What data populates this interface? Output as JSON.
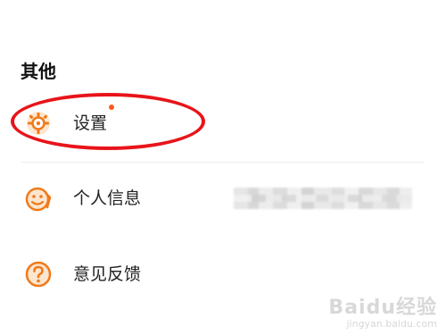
{
  "section": {
    "title": "其他"
  },
  "items": [
    {
      "label": "设置",
      "icon": "settings-gear-icon",
      "has_badge_dot": true
    },
    {
      "label": "个人信息",
      "icon": "profile-face-icon",
      "value_blurred": true
    },
    {
      "label": "意见反馈",
      "icon": "question-mark-icon"
    }
  ],
  "watermark": {
    "main": "Baidu经验",
    "sub": "jingyan.baidu.com"
  },
  "colors": {
    "accent": "#f07a1a",
    "accent_light": "#fde6cf",
    "badge_dot": "#ff5a1f",
    "highlight": "#e8141a",
    "divider": "#ececec"
  }
}
